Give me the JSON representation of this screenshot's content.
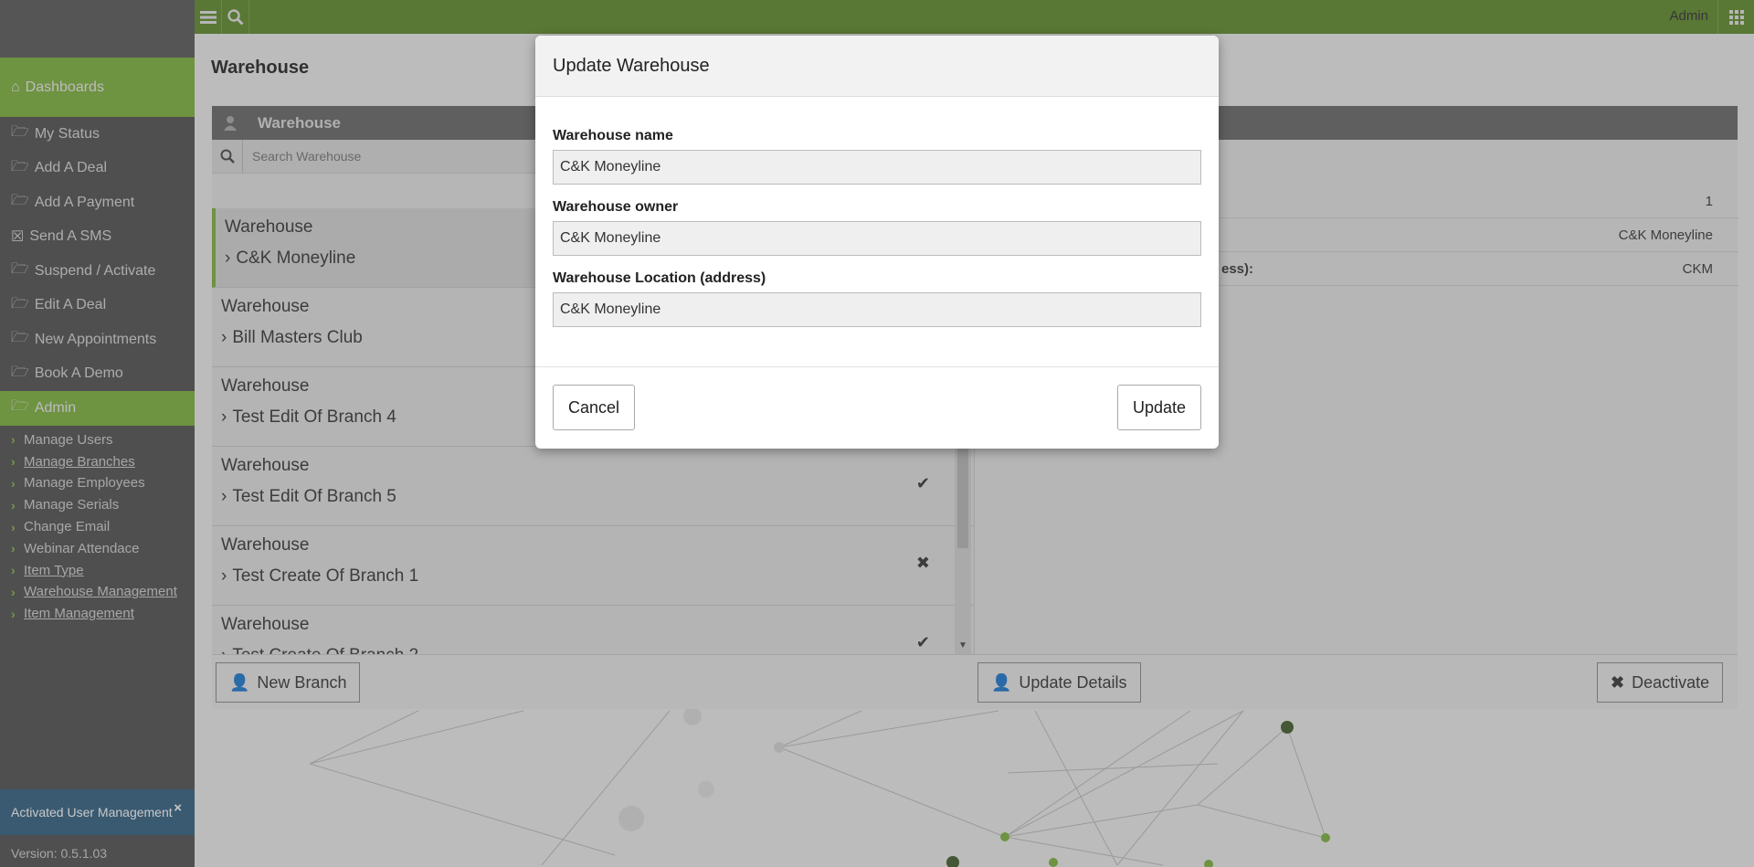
{
  "topbar": {
    "user": "Admin"
  },
  "sidebar": {
    "dashboards": "Dashboards",
    "items": [
      {
        "label": "My Status"
      },
      {
        "label": "Add A Deal"
      },
      {
        "label": "Add A Payment"
      },
      {
        "label": "Send A SMS"
      },
      {
        "label": "Suspend / Activate"
      },
      {
        "label": "Edit A Deal"
      },
      {
        "label": "New Appointments"
      },
      {
        "label": "Book A Demo"
      },
      {
        "label": "Admin"
      }
    ],
    "sub_items": [
      {
        "label": "Manage Users"
      },
      {
        "label": "Manage Branches"
      },
      {
        "label": "Manage Employees"
      },
      {
        "label": "Manage Serials"
      },
      {
        "label": "Change Email"
      },
      {
        "label": "Webinar Attendace"
      },
      {
        "label": "Item Type"
      },
      {
        "label": "Warehouse Management"
      },
      {
        "label": "Item Management"
      }
    ],
    "notice": "Activated User Management",
    "notice_close": "×",
    "version": "Version: 0.5.1.03"
  },
  "page": {
    "title": "Warehouse",
    "panel_title": "Warehouse",
    "search_placeholder": "Search Warehouse"
  },
  "list": [
    {
      "title": "Warehouse",
      "name": "C&K Moneyline",
      "status": ""
    },
    {
      "title": "Warehouse",
      "name": "Bill Masters Club",
      "status": ""
    },
    {
      "title": "Warehouse",
      "name": "Test Edit Of Branch 4",
      "status": ""
    },
    {
      "title": "Warehouse",
      "name": "Test Edit Of Branch 5",
      "status": "✔"
    },
    {
      "title": "Warehouse",
      "name": "Test Create Of Branch 1",
      "status": "✖"
    },
    {
      "title": "Warehouse",
      "name": "Test Create Of Branch 2",
      "status": "✔"
    }
  ],
  "details": {
    "row1_value": "1",
    "row2_value": "C&K Moneyline",
    "row3_label": "ess):",
    "row3_value": "CKM"
  },
  "buttons": {
    "new_branch": "New Branch",
    "update_details": "Update Details",
    "deactivate": "Deactivate"
  },
  "modal": {
    "title": "Update Warehouse",
    "fields": [
      {
        "label": "Warehouse name",
        "value": "C&K Moneyline"
      },
      {
        "label": "Warehouse owner",
        "value": "C&K Moneyline"
      },
      {
        "label": "Warehouse Location (address)",
        "value": "C&K Moneyline"
      }
    ],
    "cancel": "Cancel",
    "update": "Update"
  }
}
